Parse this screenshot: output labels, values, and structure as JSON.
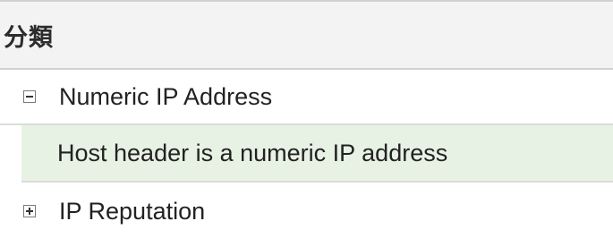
{
  "table": {
    "header": {
      "label": "分類"
    },
    "rows": [
      {
        "type": "group",
        "expanded": true,
        "toggle_icon": "collapse-minus-icon",
        "label": "Numeric IP Address"
      },
      {
        "type": "child",
        "label": "Host header is a numeric IP address"
      },
      {
        "type": "group",
        "expanded": false,
        "toggle_icon": "expand-plus-icon",
        "label": "IP Reputation"
      }
    ]
  },
  "colors": {
    "header_bg": "#f3f3f3",
    "selected_row_bg": "#e8f2e4",
    "border": "#d2d2d2",
    "text": "#222222"
  }
}
